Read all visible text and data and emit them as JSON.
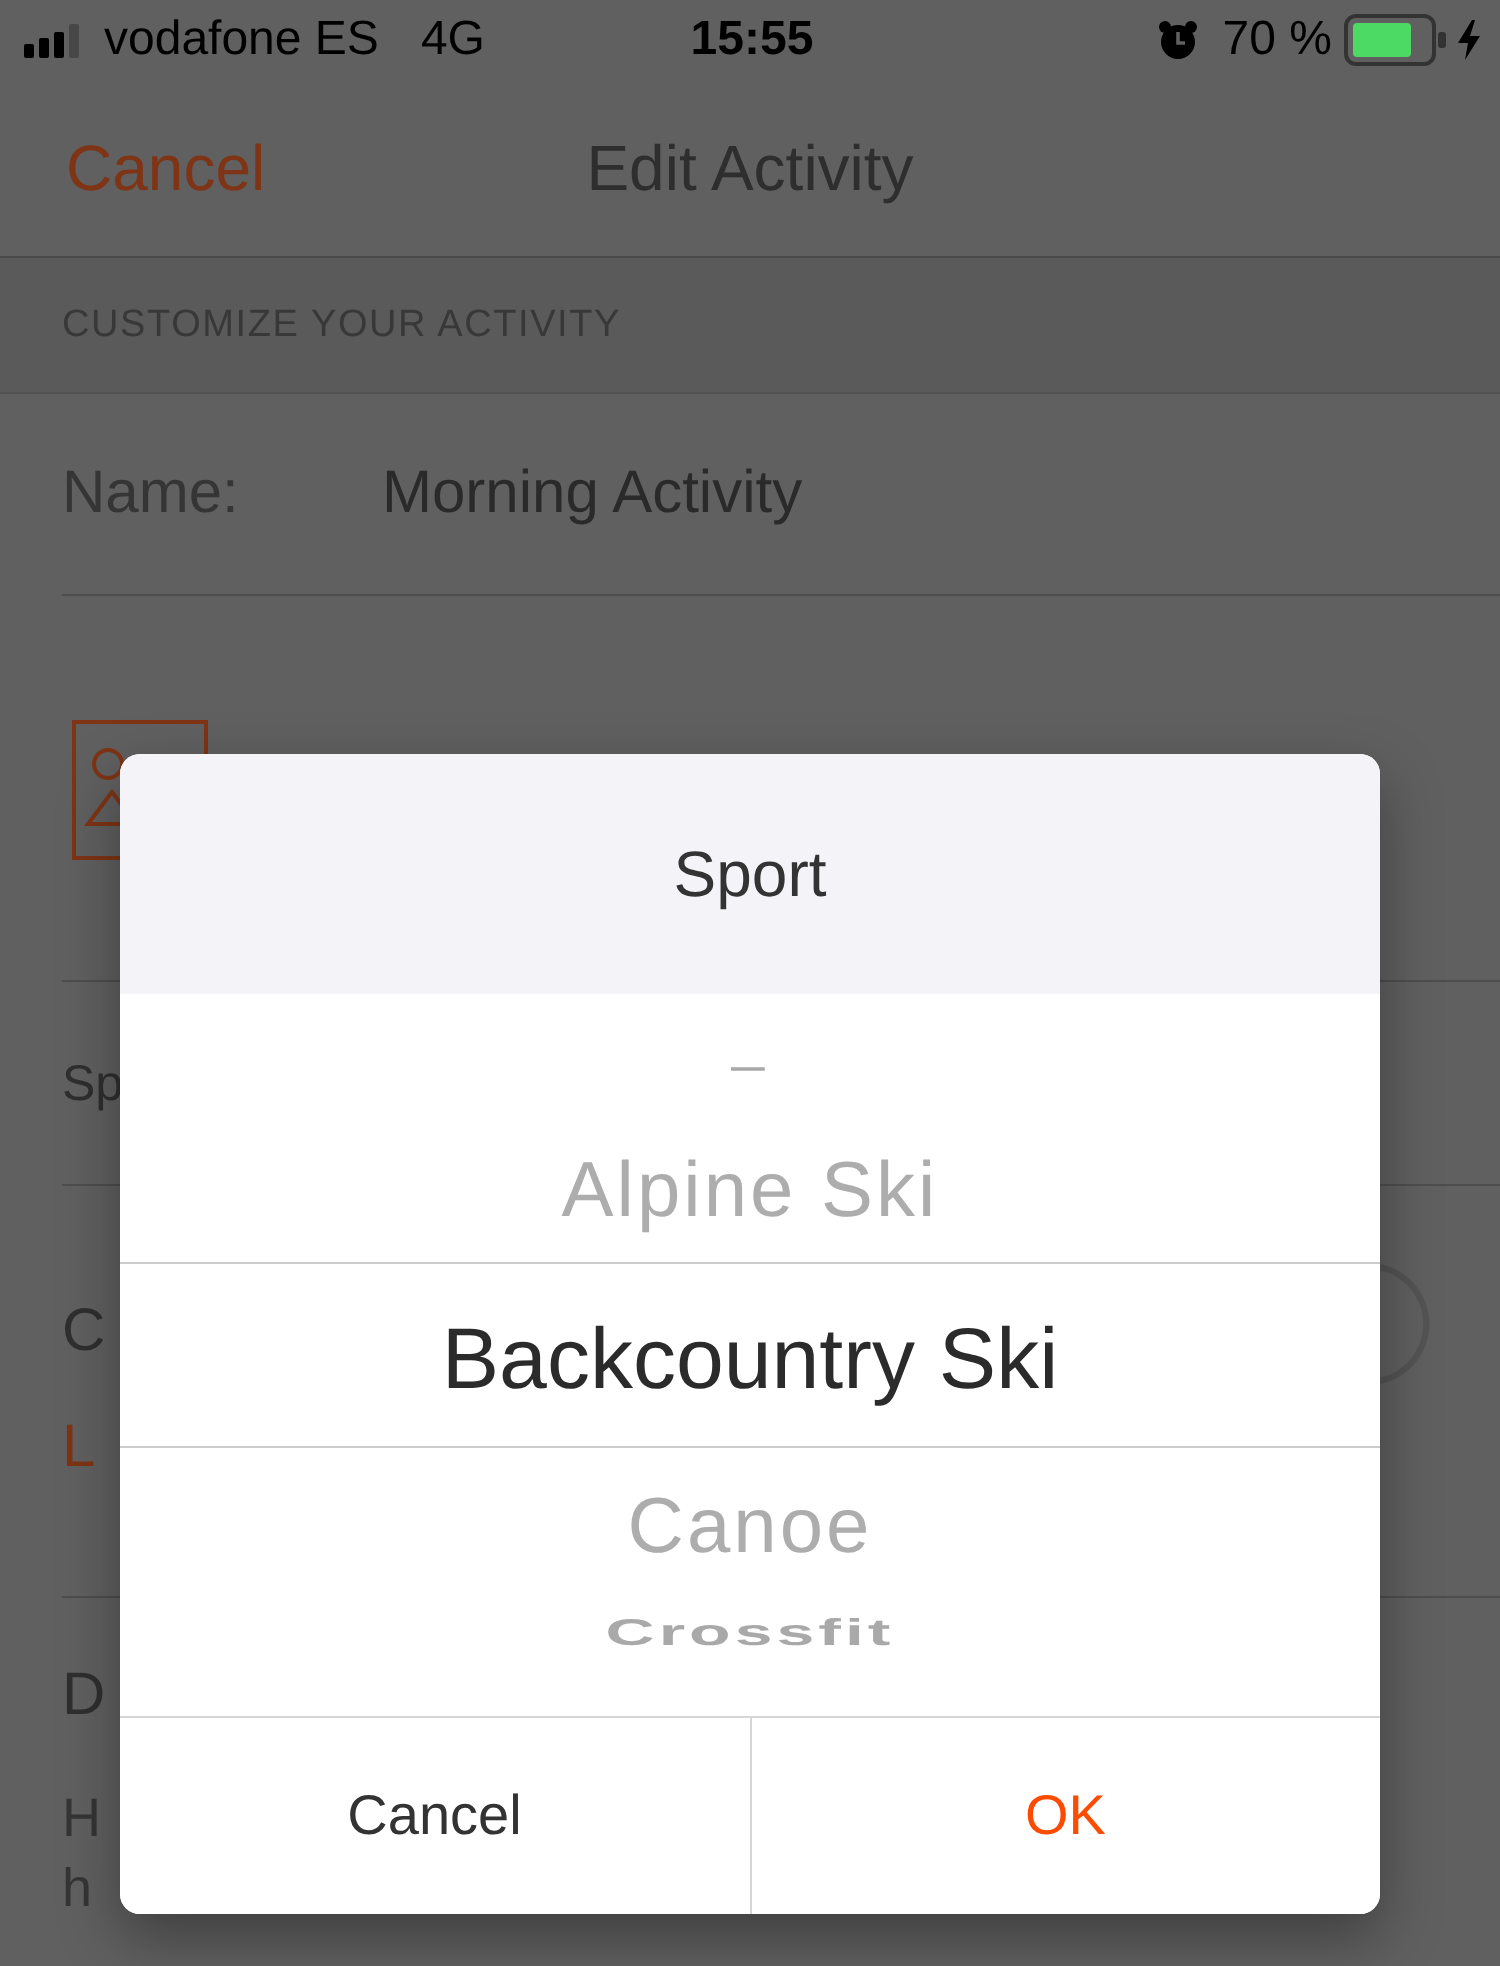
{
  "status_bar": {
    "carrier": "vodafone ES",
    "network": "4G",
    "time": "15:55",
    "battery": "70 %"
  },
  "nav_bar": {
    "cancel": "Cancel",
    "title": "Edit Activity"
  },
  "section_header": "CUSTOMIZE YOUR ACTIVITY",
  "form_rows": [
    {
      "kind": "field",
      "label": "Name:",
      "value": "Morning Activity"
    },
    {
      "kind": "photo"
    },
    {
      "kind": "label",
      "label": "Sp"
    },
    {
      "kind": "circle",
      "label": "C",
      "link": "L"
    },
    {
      "kind": "text",
      "label": "D",
      "lines": [
        "H",
        "h"
      ]
    }
  ],
  "dialog": {
    "title": "Sport",
    "options": [
      {
        "label": "–",
        "selected": false
      },
      {
        "label": "Alpine Ski",
        "selected": false
      },
      {
        "label": "Backcountry Ski",
        "selected": true
      },
      {
        "label": "Canoe",
        "selected": false
      },
      {
        "label": "Crossfit",
        "selected": false
      }
    ],
    "buttons": [
      {
        "kind": "cancel",
        "label": "Cancel"
      },
      {
        "kind": "confirm",
        "label": "OK"
      }
    ]
  }
}
